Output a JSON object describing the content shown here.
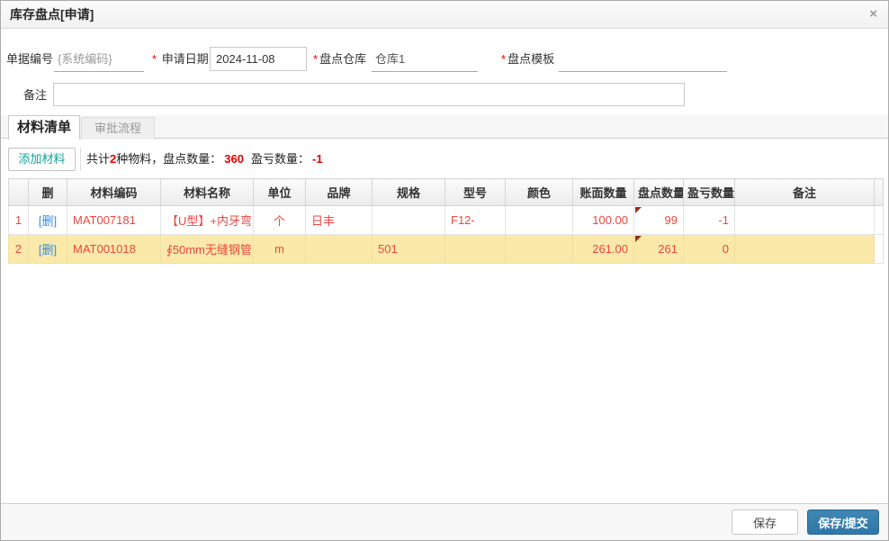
{
  "dialog": {
    "title": "库存盘点[申请]",
    "close_glyph": "×"
  },
  "form": {
    "doc_no": {
      "label": "单据编号",
      "value": "{系统编码}"
    },
    "apply_date": {
      "label": "申请日期",
      "required": "*",
      "value": "2024-11-08"
    },
    "warehouse": {
      "label": "盘点仓库",
      "required": "*",
      "value": "仓库1"
    },
    "template": {
      "label": "盘点模板",
      "required": "*",
      "value": ""
    },
    "remark": {
      "label": "备注",
      "value": ""
    }
  },
  "tabs": [
    {
      "label": "材料清单",
      "active": true
    },
    {
      "label": "审批流程",
      "active": false
    }
  ],
  "toolbar": {
    "add_button": "添加材料",
    "summary": {
      "prefix": "共计",
      "count": "2",
      "mid1": "种物料，盘点数量：",
      "total": "360",
      "mid2": "盈亏数量：",
      "diff": "-1"
    }
  },
  "table": {
    "headers": [
      "",
      "删",
      "材料编码",
      "材料名称",
      "单位",
      "品牌",
      "规格",
      "型号",
      "颜色",
      "账面数量",
      "盘点数量",
      "盈亏数量",
      "备注"
    ],
    "rows": [
      {
        "num": "1",
        "del": "[删]",
        "code": "MAT007181",
        "name": "【U型】+内牙弯",
        "unit": "个",
        "brand": "日丰",
        "spec": "",
        "model": "F12-",
        "color": "",
        "book_qty": "100.00",
        "count_qty": "99",
        "diff_qty": "-1",
        "remark": ""
      },
      {
        "num": "2",
        "del": "[删]",
        "code": "MAT001018",
        "name": "∮50mm无缝钢管",
        "unit": "m",
        "brand": "",
        "spec": "501",
        "model": "",
        "color": "",
        "book_qty": "261.00",
        "count_qty": "261",
        "diff_qty": "0",
        "remark": ""
      }
    ]
  },
  "footer": {
    "save_label": "保存",
    "submit_label": "保存/提交"
  },
  "colors": {
    "accent_blue": "#2f77a6",
    "teal": "#18a39b",
    "data_red": "#ef463e",
    "summary_red": "#e60000",
    "link_blue": "#3c8dde",
    "row_highlight": "#fae9a8",
    "marker_dark_red": "#9c2b21"
  }
}
